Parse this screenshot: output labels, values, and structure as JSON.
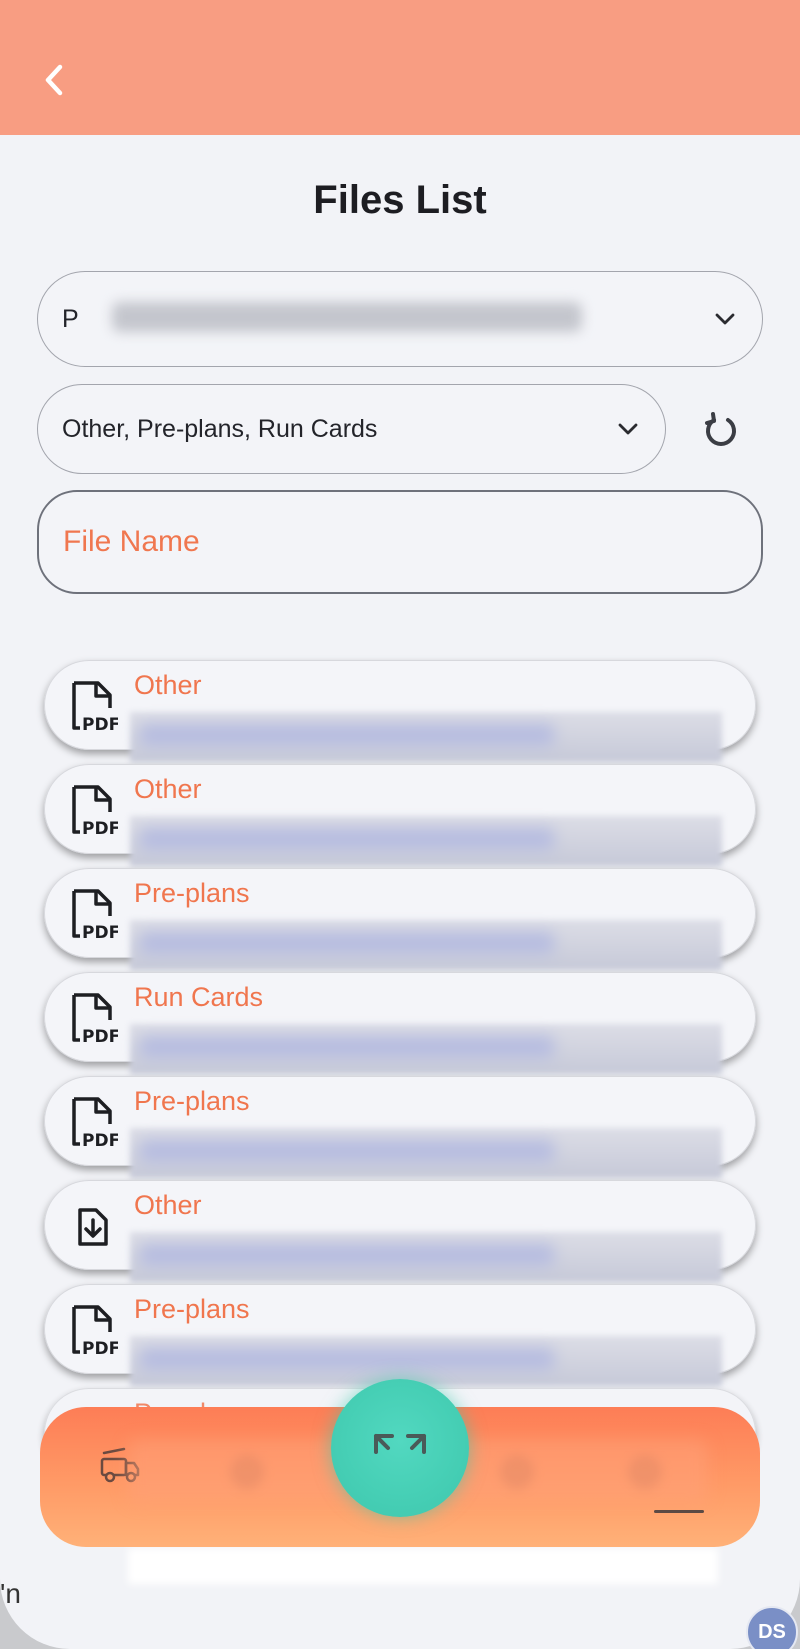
{
  "page_title": "Files List",
  "filters": {
    "department_prefix": "P",
    "categories_value": "Other, Pre-plans, Run Cards",
    "file_name_placeholder": "File Name"
  },
  "files": [
    {
      "category": "Other",
      "icon": "pdf-file-icon"
    },
    {
      "category": "Other",
      "icon": "pdf-file-icon"
    },
    {
      "category": "Pre-plans",
      "icon": "pdf-file-icon"
    },
    {
      "category": "Run Cards",
      "icon": "pdf-file-icon"
    },
    {
      "category": "Pre-plans",
      "icon": "pdf-file-icon"
    },
    {
      "category": "Other",
      "icon": "file-download-icon"
    },
    {
      "category": "Pre-plans",
      "icon": "pdf-file-icon"
    },
    {
      "category": "Pre-plans",
      "icon": "pdf-file-icon"
    }
  ],
  "outside": {
    "partial_text": "'n",
    "avatar_initials": "DS"
  },
  "colors": {
    "header": "#f89d82",
    "accent": "#f0764e",
    "fab": "#46cfb5"
  }
}
